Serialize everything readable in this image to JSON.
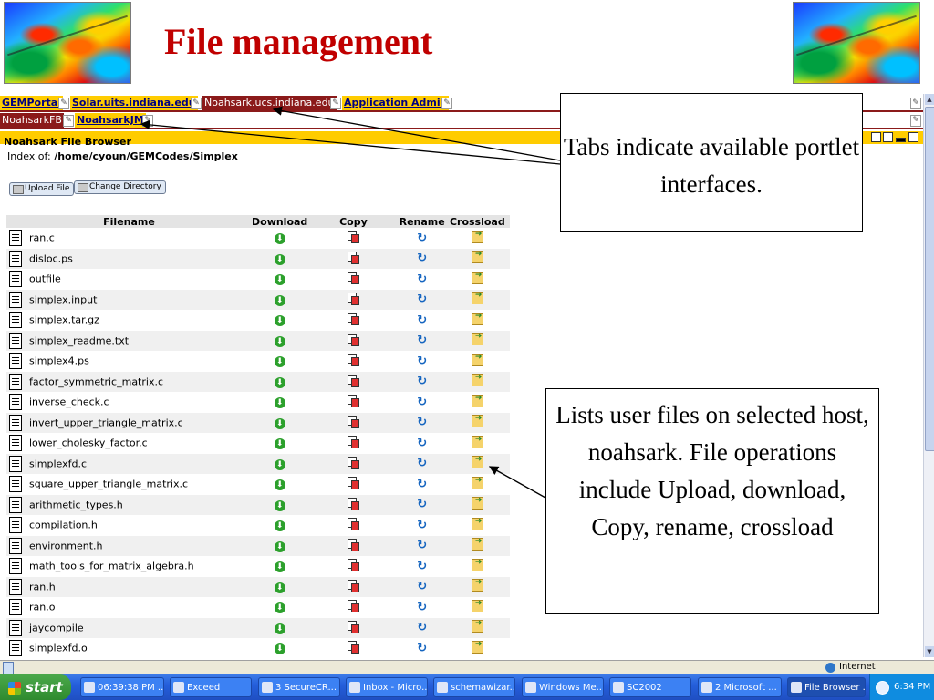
{
  "header": {
    "title": "File management"
  },
  "tabs_row1": [
    {
      "label": "GEMPortal",
      "active": false
    },
    {
      "label": "Solar.uits.indiana.edu",
      "active": false
    },
    {
      "label": "Noahsark.ucs.indiana.edu",
      "active": true
    },
    {
      "label": "Application Admin",
      "active": false
    }
  ],
  "tabs_row2": [
    {
      "label": "NoahsarkFB",
      "active": true
    },
    {
      "label": "NoahsarkJM",
      "active": false
    }
  ],
  "portlet": {
    "title": "Noahsark File Browser",
    "index_label": "Index of:",
    "index_path": "/home/cyoun/GEMCodes/Simplex",
    "upload_button": "Upload File",
    "change_dir_button": "Change Directory"
  },
  "table": {
    "headers": [
      "Filename",
      "Download",
      "Copy",
      "Rename",
      "Crossload"
    ],
    "files": [
      "ran.c",
      "disloc.ps",
      "outfile",
      "simplex.input",
      "simplex.tar.gz",
      "simplex_readme.txt",
      "simplex4.ps",
      "factor_symmetric_matrix.c",
      "inverse_check.c",
      "invert_upper_triangle_matrix.c",
      "lower_cholesky_factor.c",
      "simplexfd.c",
      "square_upper_triangle_matrix.c",
      "arithmetic_types.h",
      "compilation.h",
      "environment.h",
      "math_tools_for_matrix_algebra.h",
      "ran.h",
      "ran.o",
      "jaycompile",
      "simplexfd.o"
    ]
  },
  "callouts": {
    "tabs": "Tabs indicate available portlet interfaces.",
    "files": "Lists user files on selected host, noahsark. File operations include Upload, download, Copy, rename, crossload"
  },
  "statusbar": {
    "zone": "Internet"
  },
  "taskbar": {
    "start": "start",
    "items": [
      "06:39:38 PM ...",
      "Exceed",
      "3 SecureCR...",
      "Inbox - Micro...",
      "schemawizar...",
      "Windows Me...",
      "SC2002",
      "2 Microsoft ...",
      "File Browser ..."
    ],
    "clock": "6:34 PM"
  },
  "colors": {
    "title": "#c00000",
    "tab_active": "#8b1a1a",
    "tab_inactive": "#ffcc00",
    "accent_blue": "#245edb"
  }
}
